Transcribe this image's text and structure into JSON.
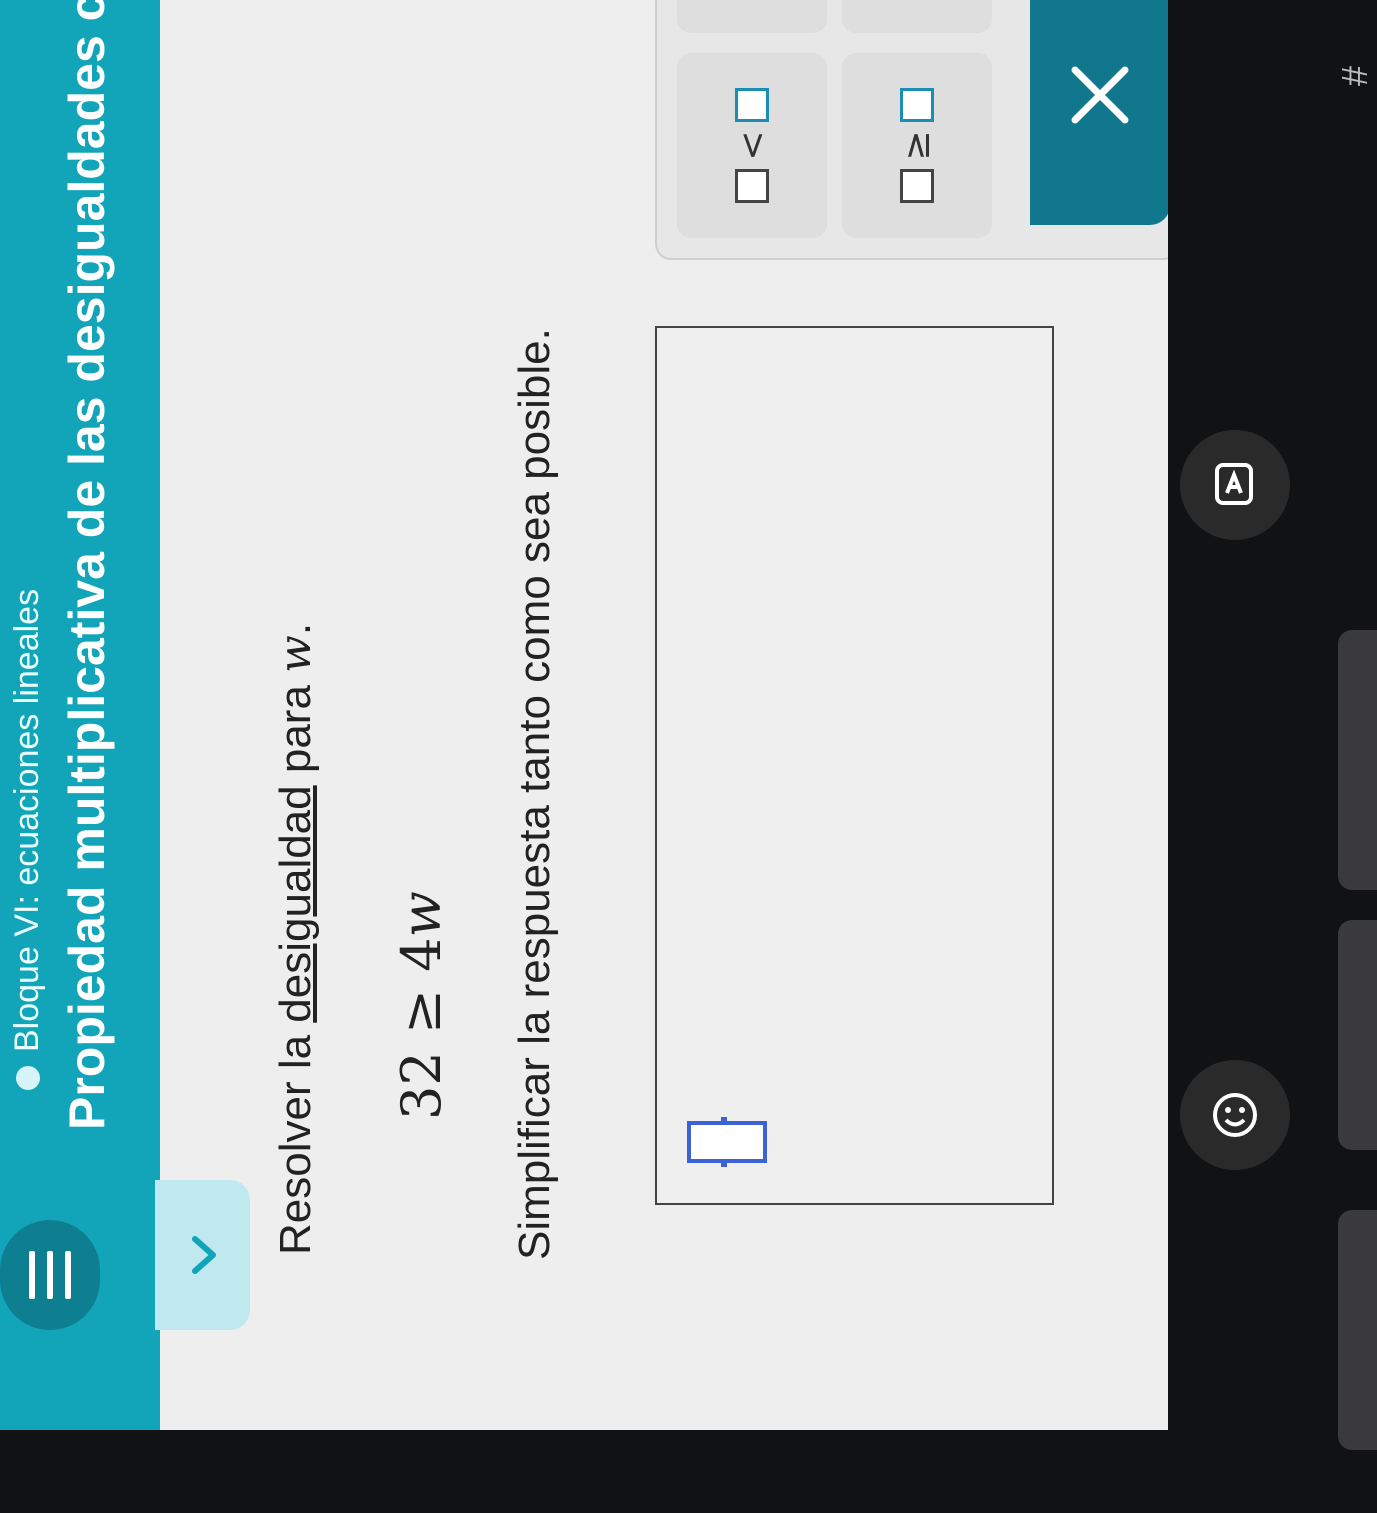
{
  "header": {
    "block_title": "Bloque VI: ecuaciones lineales",
    "lesson_title": "Propiedad multiplicativa de las desigualdades con núm"
  },
  "problem": {
    "instruction_prefix": "Resolver la ",
    "instruction_link": "desigualdad",
    "instruction_middle": " para ",
    "variable": "w",
    "instruction_suffix": ".",
    "inequality_left": "32",
    "inequality_op": "≥",
    "inequality_coef": "4",
    "inequality_var": "w",
    "simplify_text": "Simplificar la respuesta tanto como sea posible."
  },
  "keypad": {
    "less_than": "<",
    "greater_equal": "≥"
  },
  "side_keys": {
    "hash": "#"
  },
  "colors": {
    "header_bg": "#12a4b9",
    "close_bg": "#11778d",
    "cursor": "#3b63d6"
  }
}
